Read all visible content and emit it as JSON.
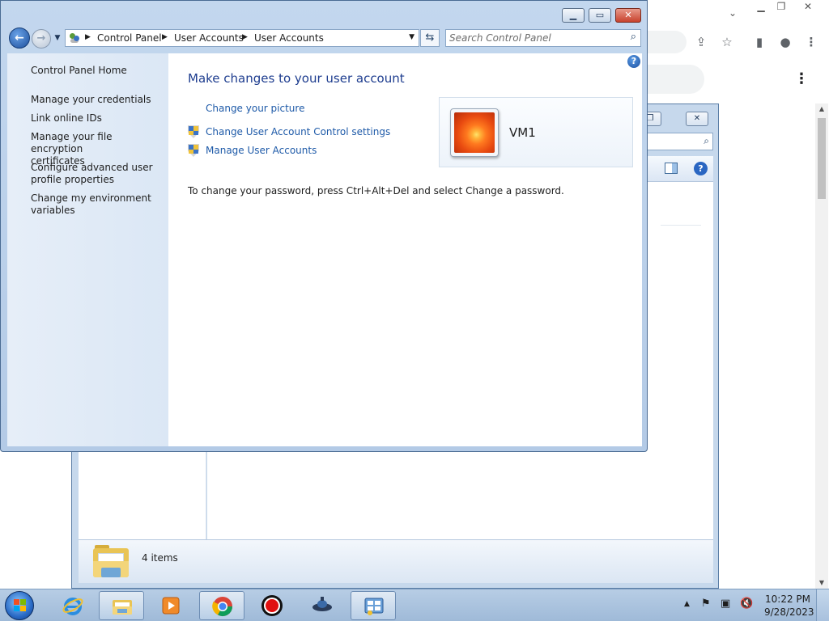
{
  "control_panel": {
    "breadcrumb": [
      "Control Panel",
      "User Accounts",
      "User Accounts"
    ],
    "search_placeholder": "Search Control Panel",
    "left_pane": {
      "home": "Control Panel Home",
      "tasks": [
        [
          "Manage your credentials"
        ],
        [
          "Link online IDs"
        ],
        [
          "Manage your file encryption",
          "certificates"
        ],
        [
          "Configure advanced user",
          "profile properties"
        ],
        [
          "Change my environment",
          "variables"
        ]
      ]
    },
    "main": {
      "title": "Make changes to your user account",
      "links": {
        "change_picture": "Change your picture",
        "uac_settings": "Change User Account Control settings",
        "manage_accounts": "Manage User Accounts"
      },
      "password_note": "To change your password, press Ctrl+Alt+Del and select Change a password.",
      "user_name": "VM1"
    }
  },
  "explorer": {
    "item_count": "4 items"
  },
  "taskbar": {
    "time": "10:22 PM",
    "date": "9/28/2023",
    "apps": [
      "explorer-icon",
      "ie-icon",
      "folder-icon",
      "media-player-icon",
      "chrome-icon",
      "record-icon",
      "network-icon",
      "control-panel-icon"
    ]
  },
  "colors": {
    "link": "#1e5aa8",
    "title": "#1e3d8f",
    "window_frame": "#c3d7ee"
  }
}
